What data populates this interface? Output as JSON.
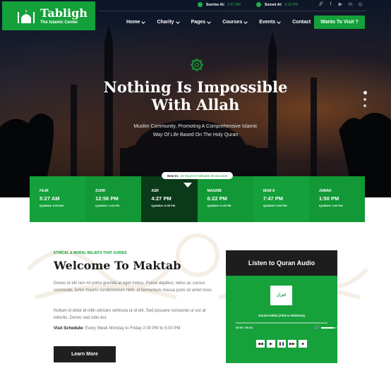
{
  "brand": {
    "name": "Tabligh",
    "tagline": "The Islamic Center"
  },
  "topbar": {
    "sunrise_label": "Sunrise At:",
    "sunrise_time": "5:57 AM",
    "sunset_label": "Sunset At:",
    "sunset_time": "6:33 PM",
    "social_icons": [
      "twitter-icon",
      "facebook-icon",
      "youtube-icon",
      "linkedin-icon",
      "instagram-icon"
    ]
  },
  "nav": {
    "items": [
      {
        "label": "Home",
        "dropdown": true
      },
      {
        "label": "Charity",
        "dropdown": true
      },
      {
        "label": "Pages",
        "dropdown": true
      },
      {
        "label": "Courses",
        "dropdown": true
      },
      {
        "label": "Events",
        "dropdown": true
      },
      {
        "label": "Contact",
        "dropdown": false
      }
    ],
    "cta": "Wants To Visit ?"
  },
  "hero": {
    "title_line1": "Nothing Is Impossible",
    "title_line2": "With Allah",
    "sub_line1": "Muslim Community, Promoting A Comprehensive Islamic",
    "sub_line2": "Way Of Life Based On The Holy Quran"
  },
  "next_prayer": {
    "label": "Next In:",
    "value": "23 Hours 57 Minutes 49 Seconds"
  },
  "prayers": [
    {
      "name": "FAJR",
      "time": "5:27 AM",
      "iqamah": "IQAMAH: 6:05 AM",
      "active": false
    },
    {
      "name": "ZUHR",
      "time": "12:56 PM",
      "iqamah": "IQAMAH: 1:30 PM",
      "active": false
    },
    {
      "name": "ASR",
      "time": "4:27 PM",
      "iqamah": "IQAMAH: 5:05 PM",
      "active": true
    },
    {
      "name": "MAGRIB",
      "time": "6:22 PM",
      "iqamah": "IQAMAH: 6:26 PM",
      "active": false
    },
    {
      "name": "ISHA'A",
      "time": "7:47 PM",
      "iqamah": "IQAMAH: 8:05 PM",
      "active": false
    },
    {
      "name": "JUMAH",
      "time": "1:50 PM",
      "iqamah": "IQAMAH: 2:00 PM",
      "active": false
    }
  ],
  "welcome": {
    "eyebrow": "ETHICAL & MORAL BELIEFS THAT GUIDES",
    "title": "Welcome To Maktab",
    "para1": "Donec id elit non mi porta gravida at eget metus. Fusce dapibus, tellus ac cursus commodo, tortor mauris condimentum nibh, ut fermentum massa justo sit amet risus.",
    "para2": "Nullam id dolor id nibh ultricies vehicula ut id elit. Sed posuere consectet ur est at lobortis. Donec sed odio dui.",
    "schedule_label": "Visit Schedule:",
    "schedule_value": "Every Week Monday to Friday 2:00 PM to 5:00 PM",
    "button": "Learn More"
  },
  "quran": {
    "title": "Listen to Quran Audio",
    "surah": "Surah-Fatiha (Abd-ur-Rahman)",
    "time": "00:00 / 56:34",
    "progress": 0.0,
    "volume": 0.8,
    "controls": [
      "rewind-icon",
      "play-icon",
      "pause-icon",
      "forward-icon",
      "stop-icon"
    ]
  },
  "colors": {
    "brand_green": "#14a03a",
    "dark": "#1d1d1d",
    "active_cell": "#0a3a18"
  }
}
